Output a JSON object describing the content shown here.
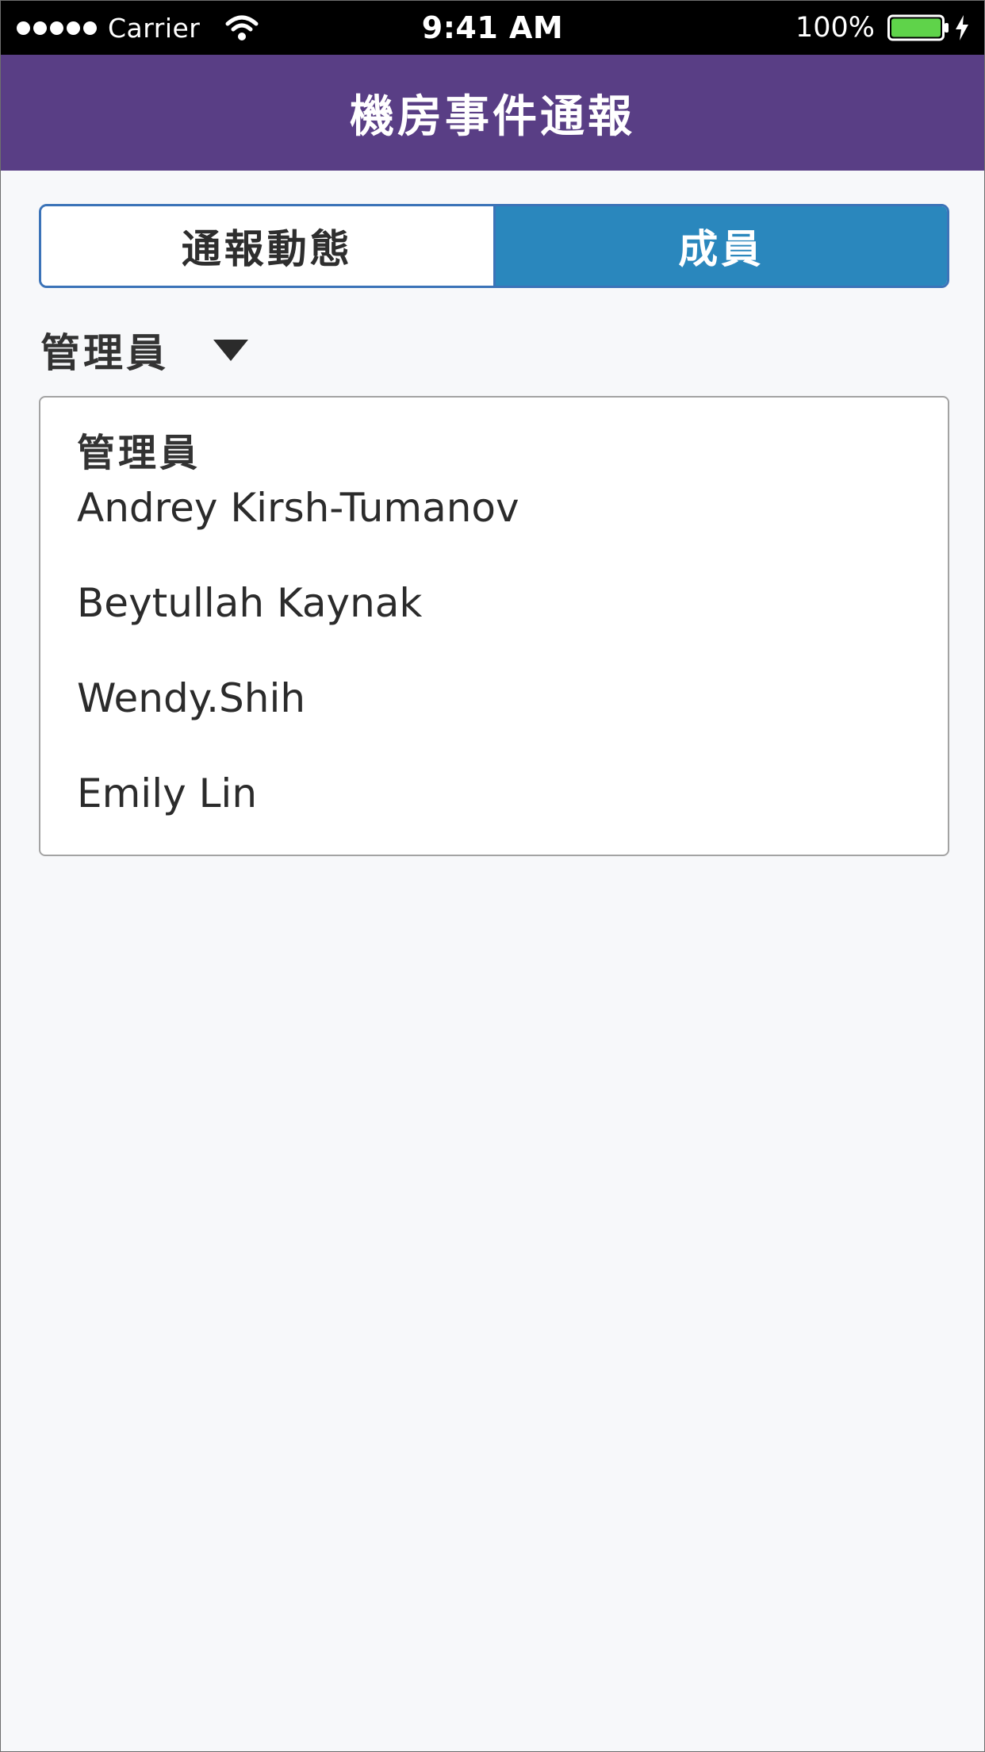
{
  "status_bar": {
    "carrier": "Carrier",
    "time": "9:41 AM",
    "battery": "100%",
    "icons": [
      "signal-dots-icon",
      "wifi-icon",
      "battery-icon",
      "charging-bolt-icon"
    ]
  },
  "nav": {
    "title": "機房事件通報"
  },
  "segments": {
    "items": [
      "通報動態",
      "成員"
    ],
    "selected": "成員"
  },
  "role_filter": {
    "selected": "管理員",
    "icon": "caret-down-icon"
  },
  "member_list": {
    "group_header": "管理員",
    "members": [
      "Andrey Kirsh-Tumanov",
      "Beytullah Kaynak",
      "Wendy.Shih",
      "Emily Lin"
    ]
  },
  "colors": {
    "nav_bar": "#593e85",
    "segment_active": "#2a87bd",
    "segment_border": "#3b73b8",
    "battery_fill": "#5fd34a",
    "background": "#f7f8fa"
  }
}
